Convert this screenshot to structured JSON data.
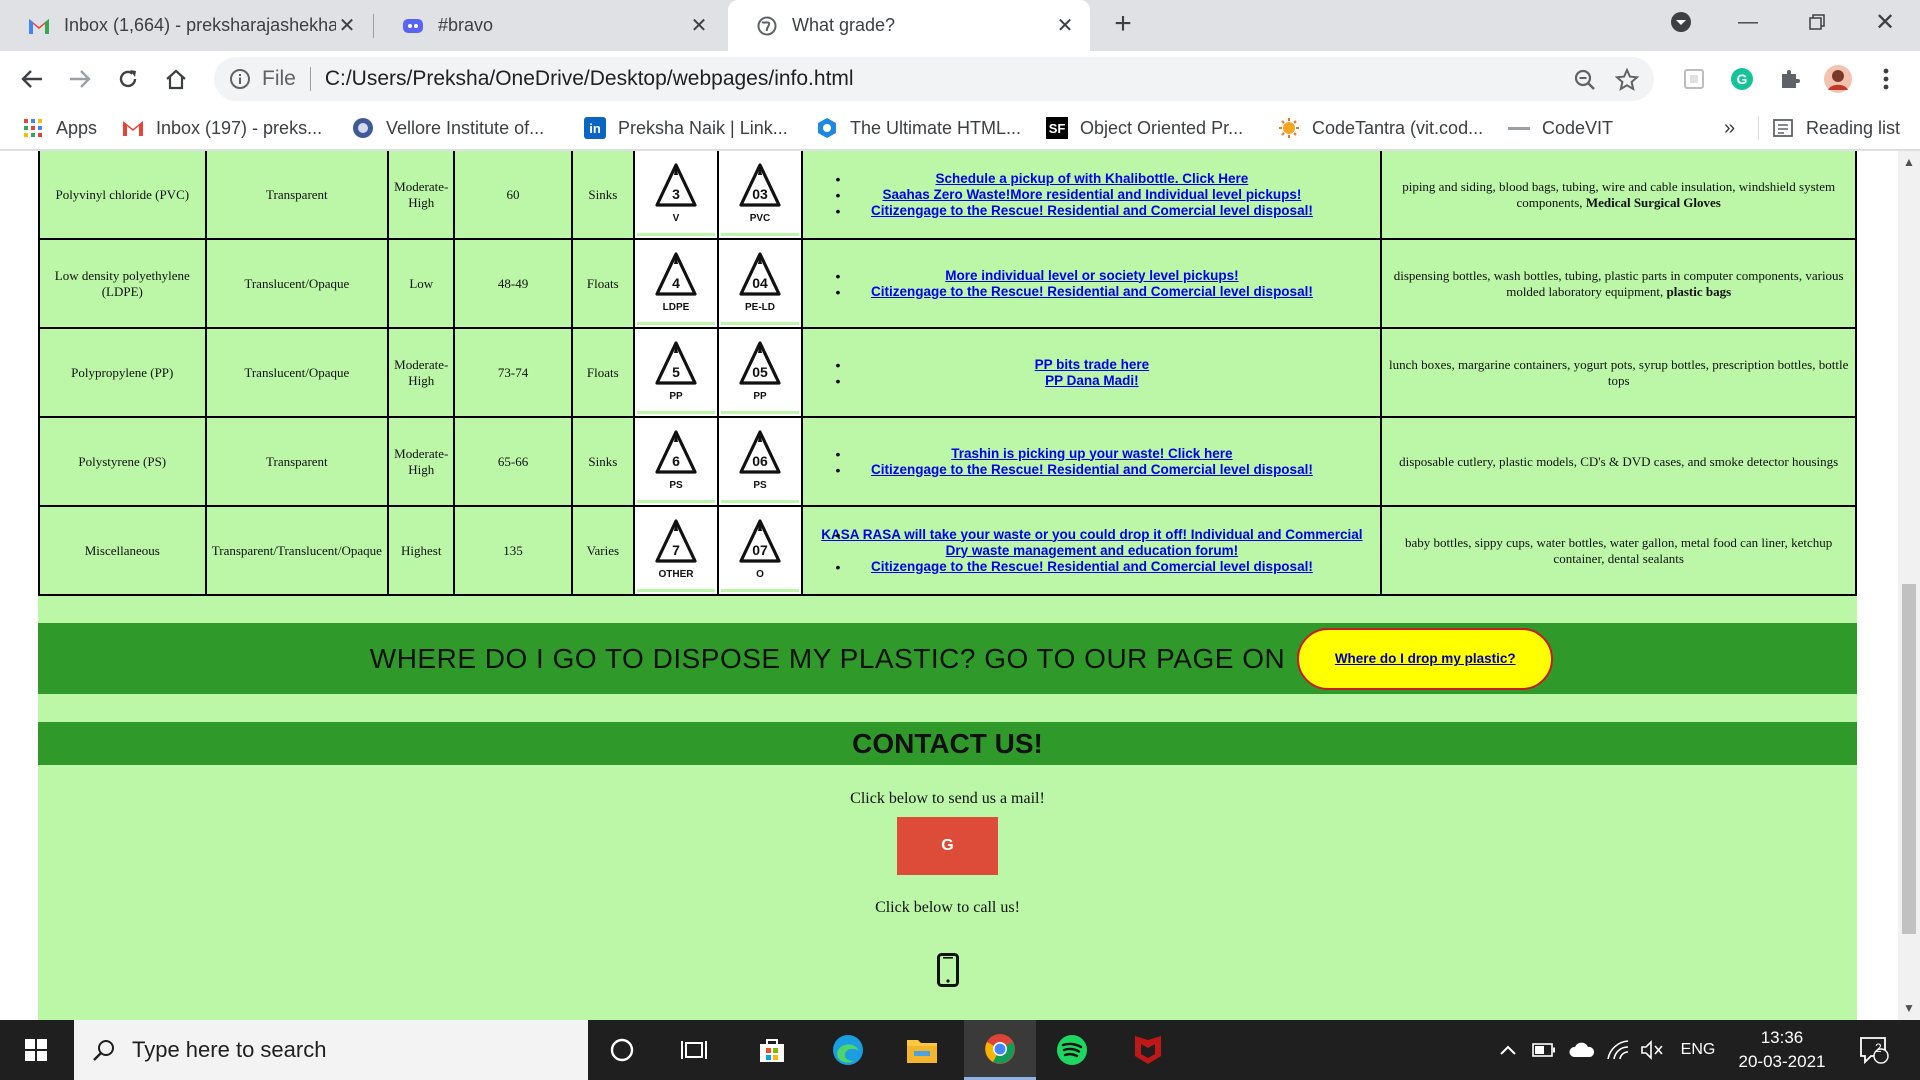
{
  "browser": {
    "tabs": [
      {
        "title": "Inbox (1,664) - preksharajashekha",
        "icon": "gmail-icon"
      },
      {
        "title": "#bravo",
        "icon": "discord-icon"
      },
      {
        "title": "What grade?",
        "icon": "globe-icon"
      }
    ],
    "url_scheme": "File",
    "url": "C:/Users/Preksha/OneDrive/Desktop/webpages/info.html",
    "bookmarks": [
      {
        "label": "Apps",
        "icon": "apps-grid-icon"
      },
      {
        "label": "Inbox (197) - preks...",
        "icon": "gmail-icon"
      },
      {
        "label": "Vellore Institute of...",
        "icon": "vit-icon"
      },
      {
        "label": "Preksha Naik | Link...",
        "icon": "linkedin-icon"
      },
      {
        "label": "The Ultimate HTML...",
        "icon": "html-icon"
      },
      {
        "label": "Object Oriented Pr...",
        "icon": "sf-icon"
      },
      {
        "label": "CodeTantra (vit.cod...",
        "icon": "codetantra-icon"
      },
      {
        "label": "CodeVIT",
        "icon": "codevit-icon"
      }
    ],
    "bookmarks_overflow": "»",
    "reading_list": "Reading list"
  },
  "table": {
    "rows": [
      {
        "name": "Polyvinyl chloride (PVC)",
        "appearance": "Transparent",
        "toxicity": "Moderate-High",
        "value": "60",
        "buoyancy": "Sinks",
        "sym1_num": "3",
        "sym1_label": "V",
        "sym2_num": "03",
        "sym2_label": "PVC",
        "links": [
          "Schedule a pickup of with Khalibottle. Click Here",
          "Saahas Zero Waste!More residential and Individual level pickups!",
          "Citizengage to the Rescue! Residential and Comercial level disposal!"
        ],
        "uses": "piping and siding, blood bags, tubing, wire and cable insulation, windshield system components,",
        "uses_bold": "Medical Surgical Gloves"
      },
      {
        "name": "Low density polyethylene (LDPE)",
        "appearance": "Translucent/Opaque",
        "toxicity": "Low",
        "value": "48-49",
        "buoyancy": "Floats",
        "sym1_num": "4",
        "sym1_label": "LDPE",
        "sym2_num": "04",
        "sym2_label": "PE-LD",
        "links": [
          "More individual level or society level pickups!",
          "Citizengage to the Rescue! Residential and Comercial level disposal!"
        ],
        "uses": "dispensing bottles, wash bottles, tubing, plastic parts in computer components, various molded laboratory equipment,",
        "uses_bold": "plastic bags"
      },
      {
        "name": "Polypropylene (PP)",
        "appearance": "Translucent/Opaque",
        "toxicity": "Moderate-High",
        "value": "73-74",
        "buoyancy": "Floats",
        "sym1_num": "5",
        "sym1_label": "PP",
        "sym2_num": "05",
        "sym2_label": "PP",
        "links": [
          "PP bits trade here",
          "PP Dana Madi!"
        ],
        "uses": "lunch boxes, margarine containers, yogurt pots, syrup bottles, prescription bottles, bottle tops",
        "uses_bold": ""
      },
      {
        "name": "Polystyrene (PS)",
        "appearance": "Transparent",
        "toxicity": "Moderate-High",
        "value": "65-66",
        "buoyancy": "Sinks",
        "sym1_num": "6",
        "sym1_label": "PS",
        "sym2_num": "06",
        "sym2_label": "PS",
        "links": [
          "Trashin is picking up your waste! Click here",
          "Citizengage to the Rescue! Residential and Comercial level disposal!"
        ],
        "uses": "disposable cutlery, plastic models, CD's & DVD cases, and smoke detector housings",
        "uses_bold": ""
      },
      {
        "name": "Miscellaneous",
        "appearance": "Transparent/Translucent/Opaque",
        "toxicity": "Highest",
        "value": "135",
        "buoyancy": "Varies",
        "sym1_num": "7",
        "sym1_label": "OTHER",
        "sym2_num": "07",
        "sym2_label": "O",
        "links": [
          "KASA RASA will take your waste or you could drop it off! Individual and Commercial Dry waste management and education forum!",
          "Citizengage to the Rescue! Residential and Comercial level disposal!"
        ],
        "uses": "baby bottles, sippy cups, water bottles, water gallon, metal food can liner, ketchup container, dental sealants",
        "uses_bold": ""
      }
    ]
  },
  "dispose": {
    "text": "WHERE DO I GO TO DISPOSE MY PLASTIC? GO TO OUR PAGE ON",
    "button": "Where do I drop my plastic?"
  },
  "contact": {
    "title": "CONTACT US!",
    "mail_text": "Click below to send us a mail!",
    "mail_button": "G",
    "call_text": "Click below to call us!"
  },
  "taskbar": {
    "search_placeholder": "Type here to search",
    "language": "ENG",
    "time": "13:36",
    "date": "20-03-2021",
    "notifications": "2"
  },
  "colors": {
    "page_bg": "#bbf7a7",
    "banner_green": "#2f9a2a",
    "link": "#0000ee",
    "drop_button": "#ffff00",
    "mail_button": "#dd4b39"
  }
}
